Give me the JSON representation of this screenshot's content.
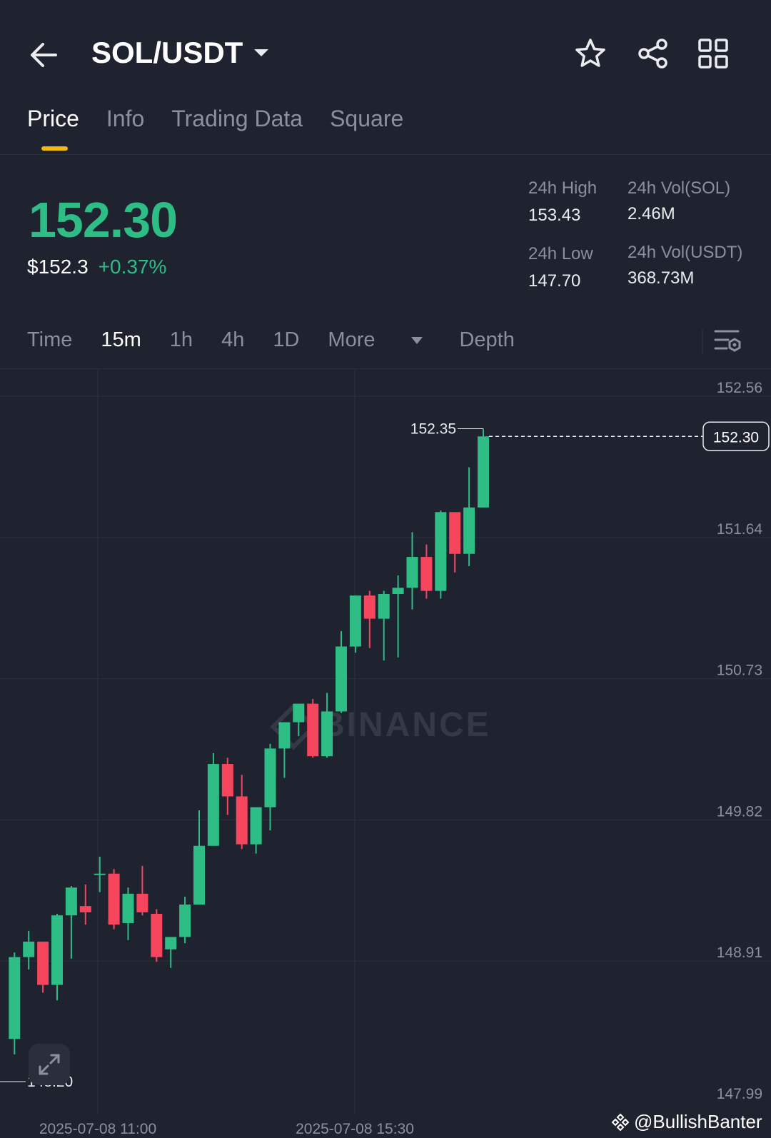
{
  "header": {
    "pair": "SOL/USDT",
    "icons": [
      "back-arrow-icon",
      "dropdown-caret-icon",
      "star-icon",
      "share-icon",
      "grid-icon"
    ]
  },
  "tabs": [
    {
      "label": "Price",
      "active": true
    },
    {
      "label": "Info",
      "active": false
    },
    {
      "label": "Trading Data",
      "active": false
    },
    {
      "label": "Square",
      "active": false
    }
  ],
  "ticker": {
    "last_price": "152.30",
    "fiat_price": "$152.3",
    "change": "+0.37%",
    "high_label": "24h High",
    "high_value": "153.43",
    "low_label": "24h Low",
    "low_value": "147.70",
    "vol_base_label": "24h Vol(SOL)",
    "vol_base_value": "2.46M",
    "vol_quote_label": "24h Vol(USDT)",
    "vol_quote_value": "368.73M"
  },
  "intervals": {
    "items": [
      "Time",
      "15m",
      "1h",
      "4h",
      "1D"
    ],
    "selected": "15m",
    "more_label": "More",
    "depth_label": "Depth"
  },
  "chart": {
    "watermark": "BINANCE",
    "high_marker": "152.35",
    "low_marker": "148.20",
    "last_price_tag": "152.30",
    "colors": {
      "up": "#2ebd85",
      "down": "#f6465d",
      "background": "#1f2330",
      "grid": "#2b303b"
    }
  },
  "footer": {
    "brand": "@BullishBanter"
  },
  "chart_data": {
    "type": "candlestick",
    "y_ticks": [
      "152.56",
      "151.64",
      "150.73",
      "149.82",
      "148.91",
      "147.99"
    ],
    "ylim": [
      147.99,
      152.56
    ],
    "x_ticks": [
      "2025-07-08 11:00",
      "2025-07-08 15:30"
    ],
    "interval": "15m",
    "candles": [
      {
        "o": 148.4,
        "h": 148.96,
        "l": 148.3,
        "c": 148.93
      },
      {
        "o": 148.93,
        "h": 149.1,
        "l": 148.85,
        "c": 149.03
      },
      {
        "o": 149.03,
        "h": 149.03,
        "l": 148.7,
        "c": 148.75
      },
      {
        "o": 148.75,
        "h": 149.21,
        "l": 148.65,
        "c": 149.2
      },
      {
        "o": 149.2,
        "h": 149.39,
        "l": 148.92,
        "c": 149.38
      },
      {
        "o": 149.26,
        "h": 149.4,
        "l": 149.14,
        "c": 149.22
      },
      {
        "o": 149.47,
        "h": 149.58,
        "l": 149.35,
        "c": 149.47
      },
      {
        "o": 149.47,
        "h": 149.5,
        "l": 149.11,
        "c": 149.14
      },
      {
        "o": 149.15,
        "h": 149.38,
        "l": 149.04,
        "c": 149.34
      },
      {
        "o": 149.34,
        "h": 149.52,
        "l": 149.2,
        "c": 149.22
      },
      {
        "o": 149.21,
        "h": 149.24,
        "l": 148.9,
        "c": 148.93
      },
      {
        "o": 148.98,
        "h": 149.06,
        "l": 148.86,
        "c": 149.06
      },
      {
        "o": 149.06,
        "h": 149.32,
        "l": 149.02,
        "c": 149.27
      },
      {
        "o": 149.27,
        "h": 149.88,
        "l": 149.27,
        "c": 149.65
      },
      {
        "o": 149.65,
        "h": 150.25,
        "l": 149.65,
        "c": 150.18
      },
      {
        "o": 150.18,
        "h": 150.22,
        "l": 149.85,
        "c": 149.97
      },
      {
        "o": 149.97,
        "h": 150.11,
        "l": 149.63,
        "c": 149.66
      },
      {
        "o": 149.66,
        "h": 149.9,
        "l": 149.6,
        "c": 149.9
      },
      {
        "o": 149.9,
        "h": 150.31,
        "l": 149.75,
        "c": 150.28
      },
      {
        "o": 150.28,
        "h": 150.45,
        "l": 150.09,
        "c": 150.45
      },
      {
        "o": 150.45,
        "h": 150.57,
        "l": 150.36,
        "c": 150.57
      },
      {
        "o": 150.57,
        "h": 150.6,
        "l": 150.22,
        "c": 150.23
      },
      {
        "o": 150.23,
        "h": 150.64,
        "l": 150.22,
        "c": 150.52
      },
      {
        "o": 150.52,
        "h": 151.04,
        "l": 150.51,
        "c": 150.94
      },
      {
        "o": 150.94,
        "h": 151.27,
        "l": 150.9,
        "c": 151.27
      },
      {
        "o": 151.27,
        "h": 151.3,
        "l": 150.93,
        "c": 151.12
      },
      {
        "o": 151.12,
        "h": 151.3,
        "l": 150.85,
        "c": 151.28
      },
      {
        "o": 151.28,
        "h": 151.4,
        "l": 150.87,
        "c": 151.32
      },
      {
        "o": 151.32,
        "h": 151.68,
        "l": 151.18,
        "c": 151.52
      },
      {
        "o": 151.52,
        "h": 151.6,
        "l": 151.25,
        "c": 151.3
      },
      {
        "o": 151.3,
        "h": 151.82,
        "l": 151.25,
        "c": 151.81
      },
      {
        "o": 151.81,
        "h": 151.81,
        "l": 151.42,
        "c": 151.54
      },
      {
        "o": 151.54,
        "h": 152.1,
        "l": 151.46,
        "c": 151.84
      },
      {
        "o": 151.84,
        "h": 152.35,
        "l": 151.84,
        "c": 152.3
      }
    ]
  }
}
